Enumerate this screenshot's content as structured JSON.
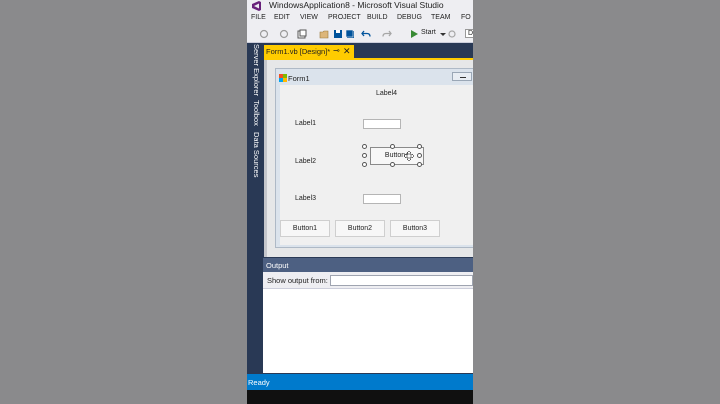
{
  "window": {
    "title": "WindowsApplication8 - Microsoft Visual Studio"
  },
  "menu": {
    "items": [
      "FILE",
      "EDIT",
      "VIEW",
      "PROJECT",
      "BUILD",
      "DEBUG",
      "TEAM",
      "FO"
    ]
  },
  "toolbar": {
    "start_label": "Start",
    "config_label": "D"
  },
  "side_tabs": [
    "Server Explorer",
    "Toolbox",
    "Data Sources"
  ],
  "document_tab": {
    "label": "Form1.vb [Design]*",
    "pin": "⊸",
    "close": "✕"
  },
  "form": {
    "title": "Form1",
    "labels": {
      "label4": "Label4",
      "label1": "Label1",
      "label2": "Label2",
      "label3": "Label3"
    },
    "selected_button": "Button4",
    "buttons": [
      "Button1",
      "Button2",
      "Button3"
    ]
  },
  "output": {
    "title": "Output",
    "show_from_label": "Show output from:"
  },
  "status": {
    "text": "Ready"
  },
  "colors": {
    "accent": "#007acc",
    "tab_active": "#ffcc00",
    "frame": "#293955"
  }
}
